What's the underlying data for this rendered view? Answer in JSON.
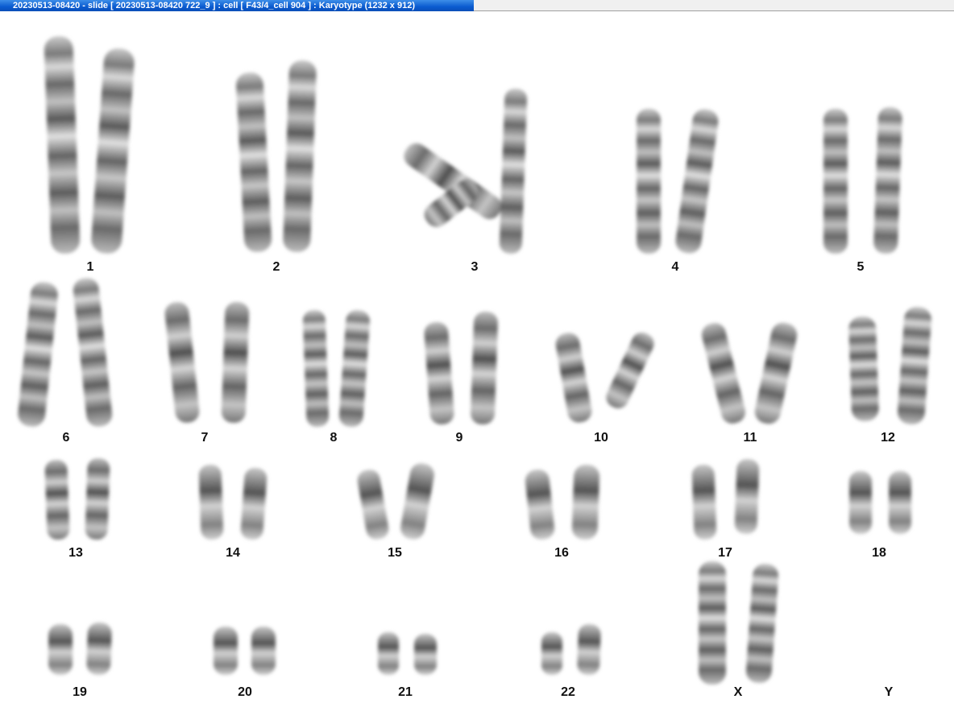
{
  "window": {
    "title": "20230513-08420 - slide [ 20230513-08420 722_9 ] : cell [ F43/4_cell 904 ] : Karyotype  (1232 x 912)"
  },
  "karyotype": {
    "labels": [
      "1",
      "2",
      "3",
      "4",
      "5",
      "6",
      "7",
      "8",
      "9",
      "10",
      "11",
      "12",
      "13",
      "14",
      "15",
      "16",
      "17",
      "18",
      "19",
      "20",
      "21",
      "22",
      "X",
      "Y"
    ]
  }
}
